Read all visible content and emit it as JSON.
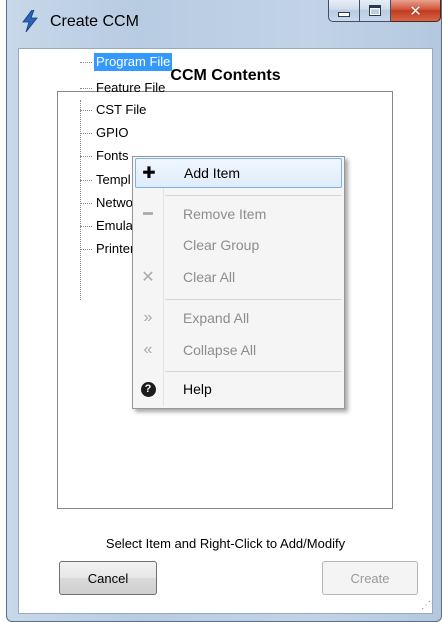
{
  "window": {
    "title": "Create CCM",
    "controls": {
      "minimize_icon": "minimize-icon",
      "maximize_icon": "maximize-icon",
      "close_glyph": "✕"
    }
  },
  "dialog": {
    "heading": "CCM Contents",
    "hint": "Select Item and Right-Click to Add/Modify",
    "cancel_label": "Cancel",
    "create_label": "Create"
  },
  "tree": {
    "items": [
      {
        "label": "Program File",
        "selected": true
      },
      {
        "label": "Feature File"
      },
      {
        "label": "CST File"
      },
      {
        "label": "GPIO"
      },
      {
        "label": "Fonts"
      },
      {
        "label": "Templ"
      },
      {
        "label": "Netwo"
      },
      {
        "label": "Emula"
      },
      {
        "label": "Printer"
      }
    ]
  },
  "context_menu": {
    "items": [
      {
        "label": "Add Item",
        "icon": "plus-icon",
        "glyph": "✚",
        "enabled": true,
        "highlighted": true
      },
      {
        "label": "Remove Item",
        "icon": "minus-icon",
        "glyph": "━",
        "enabled": false
      },
      {
        "label": "Clear Group",
        "icon": "",
        "glyph": "",
        "enabled": false
      },
      {
        "label": "Clear All",
        "icon": "x-icon",
        "glyph": "✕",
        "enabled": false
      },
      {
        "label": "Expand All",
        "icon": "double-chevron-right-icon",
        "glyph": "»",
        "enabled": false
      },
      {
        "label": "Collapse All",
        "icon": "double-chevron-left-icon",
        "glyph": "«",
        "enabled": false
      },
      {
        "label": "Help",
        "icon": "help-icon",
        "glyph": "?",
        "enabled": true
      }
    ]
  },
  "colors": {
    "selection": "#3399ff",
    "menu_highlight_border": "#7fb0e8",
    "close_button": "#c23a1e"
  }
}
